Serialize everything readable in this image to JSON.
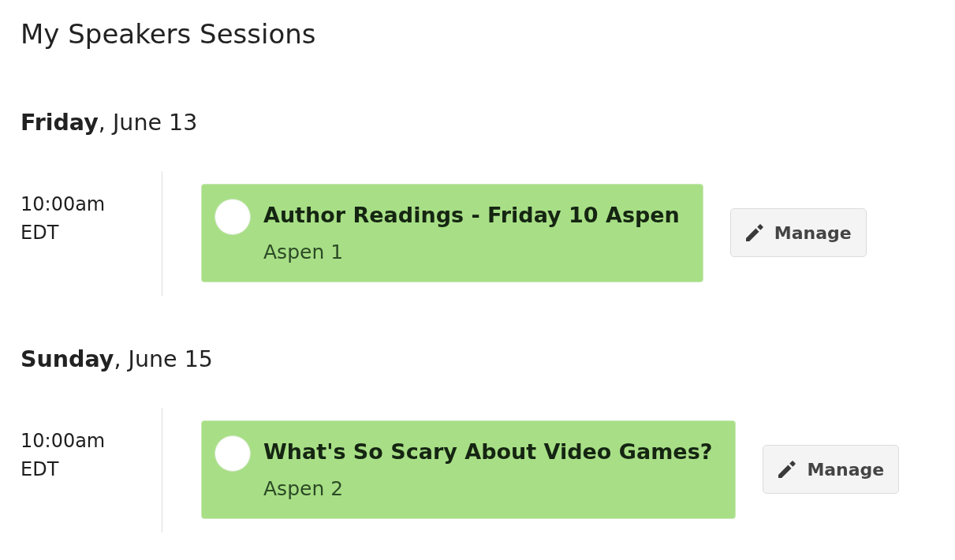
{
  "page": {
    "title": "My Speakers Sessions"
  },
  "days": [
    {
      "heading": "**Friday**, June 13",
      "sessions": [
        {
          "time": "10:00am",
          "zone": "EDT",
          "title": "Author Readings - Friday 10 Aspen",
          "room": "Aspen 1",
          "button": "Manage"
        }
      ]
    },
    {
      "heading": "**Sunday**, June 15",
      "sessions": [
        {
          "time": "10:00am",
          "zone": "EDT",
          "title": "What's So Scary About Video Games?",
          "room": "Aspen 2",
          "button": "Manage"
        }
      ]
    }
  ]
}
